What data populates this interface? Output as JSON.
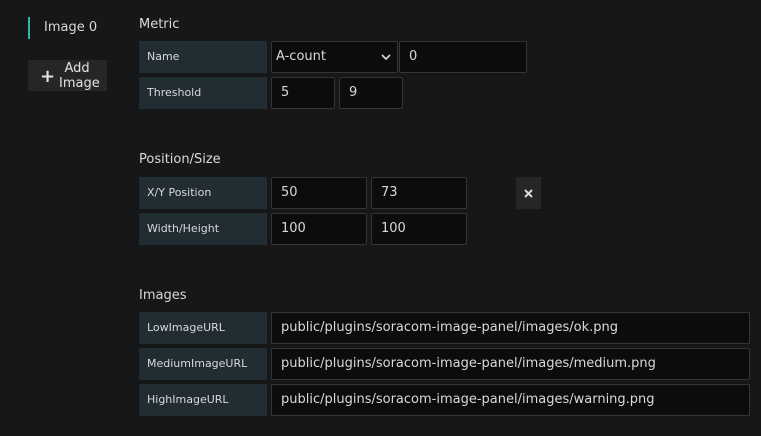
{
  "tabs": {
    "items": [
      {
        "label": "Image 0",
        "active": true
      }
    ],
    "add_label": "Add Image",
    "accent_color": "#33b5a8"
  },
  "metric": {
    "title": "Metric",
    "name_label": "Name",
    "name_select_value": "A-count",
    "name_index_value": "0",
    "threshold_label": "Threshold",
    "threshold_low": "5",
    "threshold_high": "9"
  },
  "position": {
    "title": "Position/Size",
    "xy_label": "X/Y Position",
    "x_value": "50",
    "y_value": "73",
    "wh_label": "Width/Height",
    "width_value": "100",
    "height_value": "100",
    "remove_icon": "close-icon"
  },
  "images": {
    "title": "Images",
    "low_label": "LowImageURL",
    "low_value": "public/plugins/soracom-image-panel/images/ok.png",
    "medium_label": "MediumImageURL",
    "medium_value": "public/plugins/soracom-image-panel/images/medium.png",
    "high_label": "HighImageURL",
    "high_value": "public/plugins/soracom-image-panel/images/warning.png"
  }
}
